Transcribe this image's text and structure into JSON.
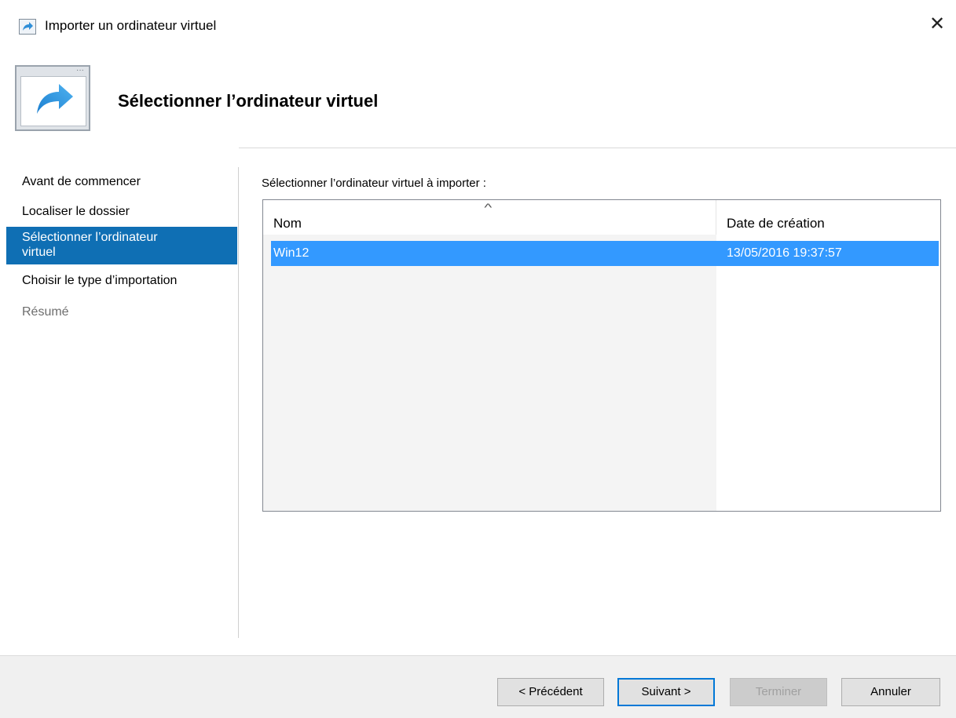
{
  "window": {
    "title": "Importer un ordinateur virtuel",
    "close_glyph": "✕"
  },
  "header": {
    "heading": "Sélectionner l’ordinateur virtuel",
    "icon": "import-arrow-icon"
  },
  "nav": {
    "items": [
      {
        "label": "Avant de commencer",
        "state": "normal"
      },
      {
        "label": "Localiser le dossier",
        "state": "normal"
      },
      {
        "label_line1": "Sélectionner l’ordinateur",
        "label_line2": "virtuel",
        "state": "selected"
      },
      {
        "label": "Choisir le type d’importation",
        "state": "normal"
      },
      {
        "label": "Résumé",
        "state": "disabled"
      }
    ]
  },
  "content": {
    "label": "Sélectionner l’ordinateur virtuel à importer :",
    "list": {
      "columns": [
        "Nom",
        "Date de création"
      ],
      "sort_glyph": "^",
      "rows": [
        {
          "name": "Win12",
          "date": "13/05/2016 19:37:57",
          "selected": true
        }
      ]
    }
  },
  "footer": {
    "prev_label": "< Précédent",
    "next_label": "Suivant >",
    "finish_label": "Terminer",
    "cancel_label": "Annuler"
  },
  "colors": {
    "selection_nav": "#0f6fb4",
    "selection_list": "#3399ff",
    "primary_border": "#0078d7"
  }
}
